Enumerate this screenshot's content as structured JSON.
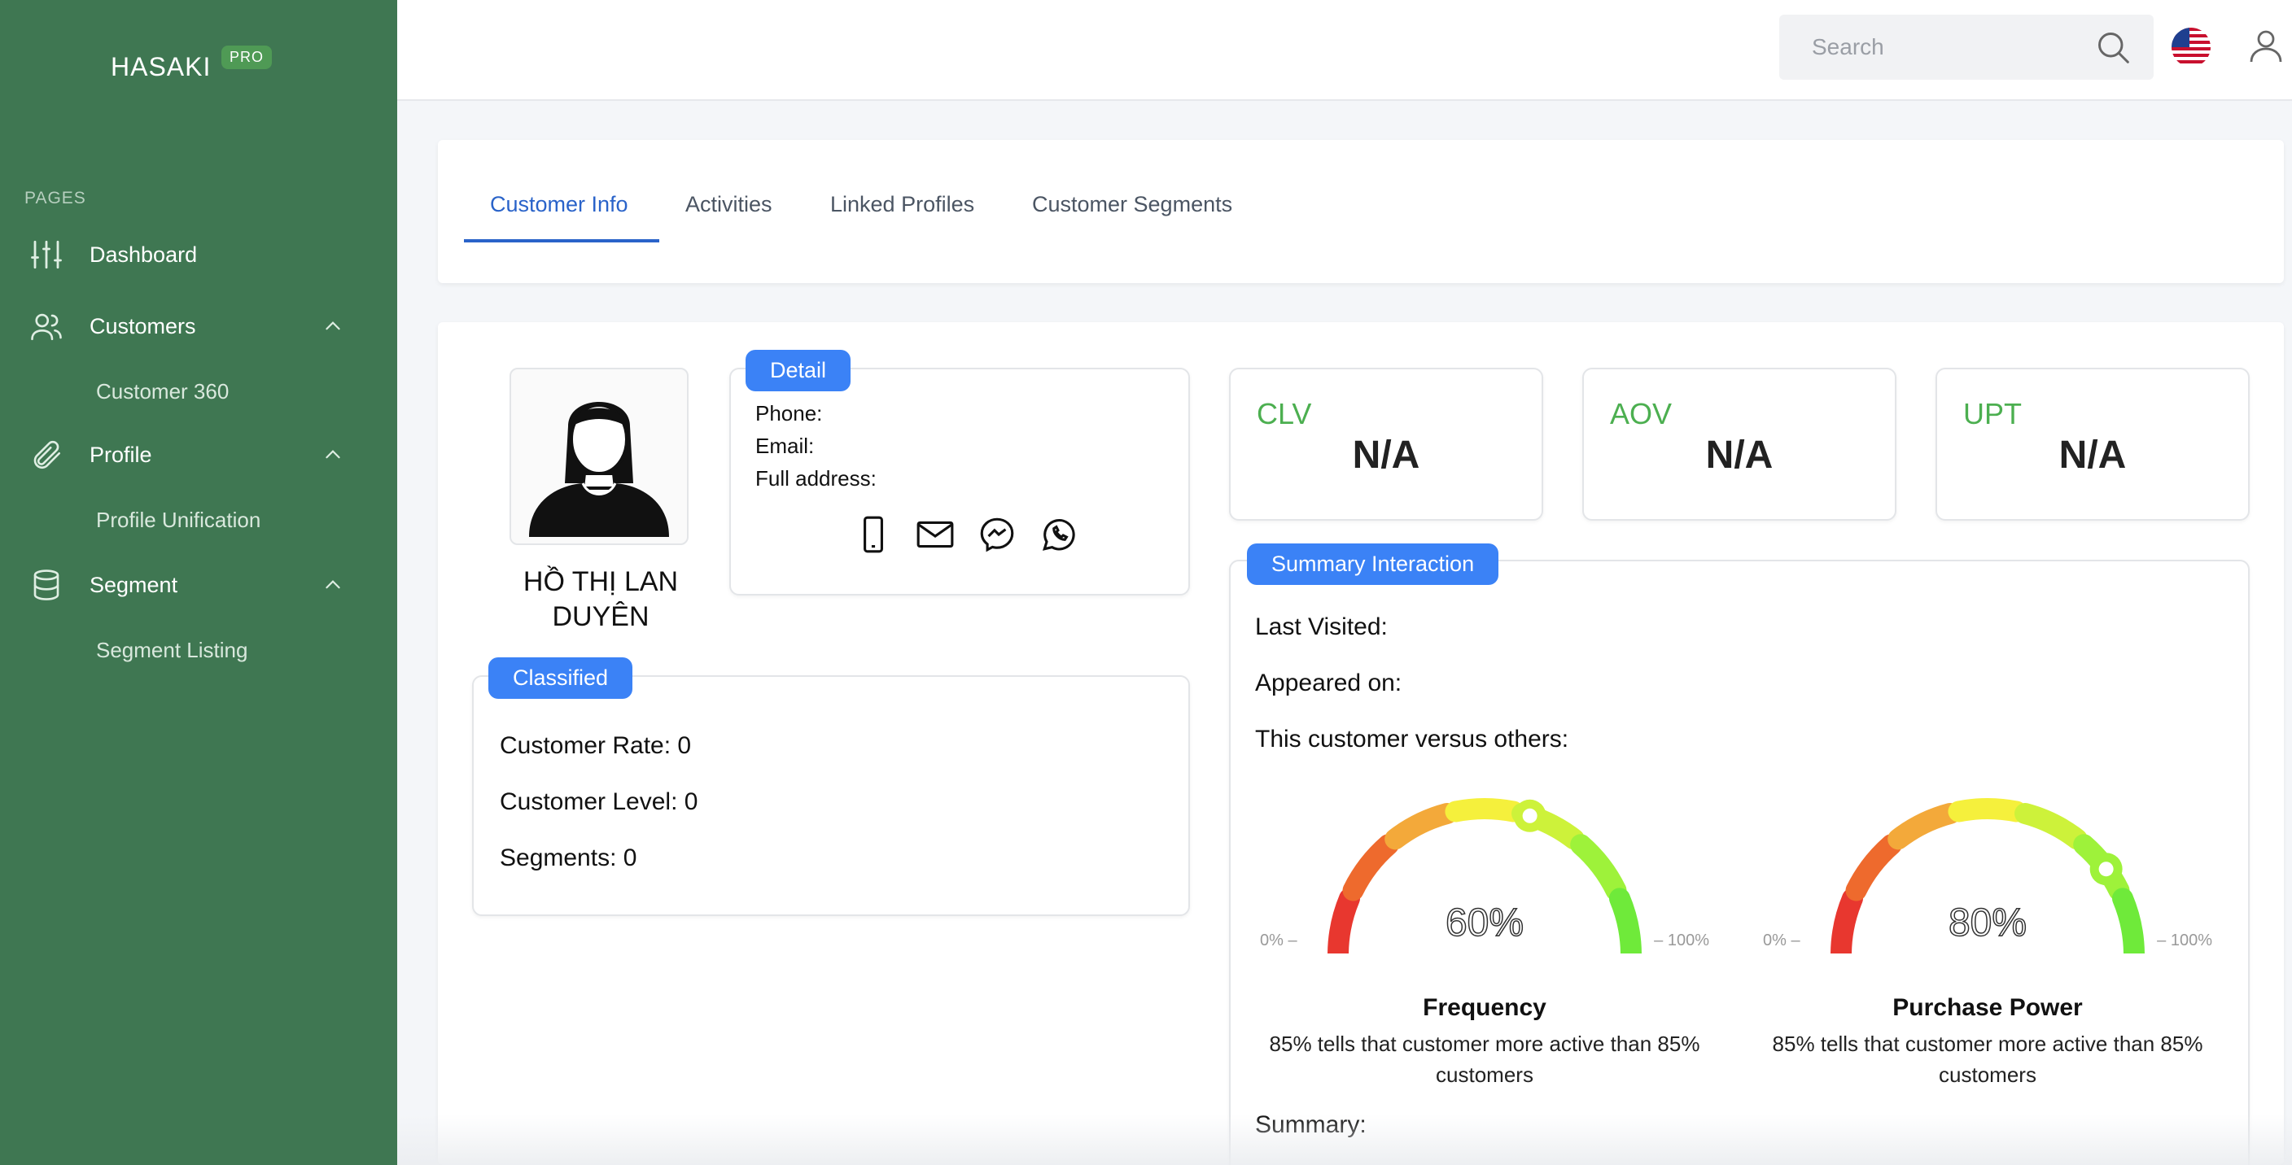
{
  "app": {
    "brand": "HASAKI",
    "badge": "PRO"
  },
  "sidebar": {
    "section_label": "PAGES",
    "items": [
      {
        "label": "Dashboard",
        "icon": "sliders-icon"
      },
      {
        "label": "Customers",
        "icon": "users-icon",
        "expanded": true,
        "children": [
          {
            "label": "Customer 360"
          }
        ]
      },
      {
        "label": "Profile",
        "icon": "paperclip-icon",
        "expanded": true,
        "children": [
          {
            "label": "Profile Unification"
          }
        ]
      },
      {
        "label": "Segment",
        "icon": "database-icon",
        "expanded": true,
        "children": [
          {
            "label": "Segment Listing"
          }
        ]
      }
    ]
  },
  "topbar": {
    "search_placeholder": "Search",
    "flag": "us-flag-icon",
    "user": "user-icon"
  },
  "tabs": [
    {
      "label": "Customer Info",
      "active": true
    },
    {
      "label": "Activities",
      "active": false
    },
    {
      "label": "Linked Profiles",
      "active": false
    },
    {
      "label": "Customer Segments",
      "active": false
    }
  ],
  "customer": {
    "name": "HỒ THỊ LAN DUYÊN"
  },
  "detail": {
    "pill": "Detail",
    "phone_label": "Phone:",
    "email_label": "Email:",
    "address_label": "Full address:",
    "contact_icons": [
      "phone-icon",
      "mail-icon",
      "messenger-icon",
      "whatsapp-icon"
    ]
  },
  "classified": {
    "pill": "Classified",
    "rate": "Customer Rate: 0",
    "level": "Customer Level: 0",
    "segments": "Segments: 0"
  },
  "metrics": [
    {
      "label": "CLV",
      "value": "N/A"
    },
    {
      "label": "AOV",
      "value": "N/A"
    },
    {
      "label": "UPT",
      "value": "N/A"
    }
  ],
  "summary": {
    "pill": "Summary Interaction",
    "last_visited": "Last Visited:",
    "appeared_on": "Appeared on:",
    "versus": "This customer versus others:",
    "summary_label": "Summary:"
  },
  "gauges": [
    {
      "title": "Frequency",
      "value": 60,
      "value_text": "60%",
      "min_label": "0%",
      "max_label": "100%",
      "description": "85% tells that customer more active than 85% customers"
    },
    {
      "title": "Purchase Power",
      "value": 80,
      "value_text": "80%",
      "min_label": "0%",
      "max_label": "100%",
      "description": "85% tells that customer more active than 85% customers"
    }
  ],
  "colors": {
    "sidebar": "#3f7752",
    "accent_blue": "#3b82f6",
    "tab_active": "#2a63c9",
    "metric_green": "#4caf50"
  }
}
